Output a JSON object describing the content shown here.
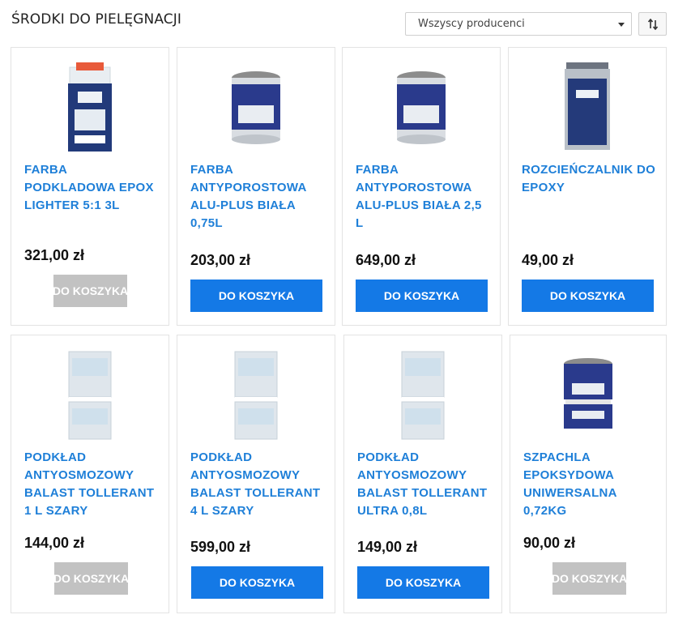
{
  "page": {
    "title": "ŚRODKI DO PIELĘGNACJI"
  },
  "filters": {
    "producer_selected": "Wszyscy producenci",
    "sort_icon": "sort-arrows-icon"
  },
  "products": [
    {
      "name": "FARBA PODKLADOWA EPOX LIGHTER 5:1 3L",
      "price": "321,00 zł",
      "button": "DO KOSZYKA",
      "button_state": "disabled",
      "image": "epoxy-kit-product-image"
    },
    {
      "name": "FARBA ANTYPOROSTOWA ALU-PLUS BIAŁA 0,75L",
      "price": "203,00 zł",
      "button": "DO KOSZYKA",
      "button_state": "active",
      "image": "paint-can-product-image"
    },
    {
      "name": "FARBA ANTYPOROSTOWA ALU-PLUS BIAŁA 2,5 L",
      "price": "649,00 zł",
      "button": "DO KOSZYKA",
      "button_state": "active",
      "image": "paint-can-product-image"
    },
    {
      "name": "ROZCIEŃCZALNIK DO EPOXY",
      "price": "49,00 zł",
      "button": "DO KOSZYKA",
      "button_state": "active",
      "image": "thinner-can-product-image"
    },
    {
      "name": "PODKŁAD ANTYOSMOZOWY BALAST TOLLERANT 1 L SZARY",
      "price": "144,00 zł",
      "button": "DO KOSZYKA",
      "button_state": "disabled",
      "image": "primer-kit-product-image"
    },
    {
      "name": "PODKŁAD ANTYOSMOZOWY BALAST TOLLERANT 4 L SZARY",
      "price": "599,00 zł",
      "button": "DO KOSZYKA",
      "button_state": "active",
      "image": "primer-kit-product-image"
    },
    {
      "name": "PODKŁAD ANTYOSMOZOWY BALAST TOLLERANT ULTRA 0,8L",
      "price": "149,00 zł",
      "button": "DO KOSZYKA",
      "button_state": "active",
      "image": "primer-kit-product-image"
    },
    {
      "name": "SZPACHLA EPOKSYDOWA UNIWERSALNA 0,72KG",
      "price": "90,00 zł",
      "button": "DO KOSZYKA",
      "button_state": "disabled",
      "image": "filler-kit-product-image"
    }
  ],
  "colors": {
    "link": "#1e7fd8",
    "button_active": "#1479e6",
    "button_disabled": "#c2c2c2"
  }
}
